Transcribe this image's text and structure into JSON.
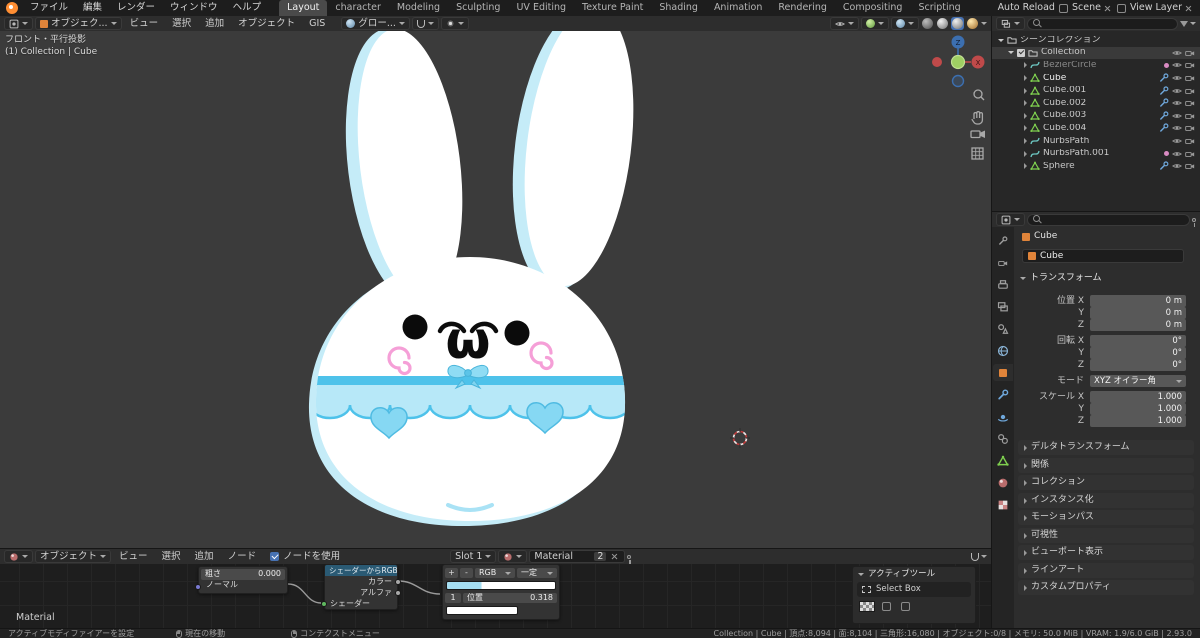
{
  "topbar": {
    "menus": [
      "ファイル",
      "編集",
      "レンダー",
      "ウィンドウ",
      "ヘルプ"
    ],
    "workspaces": [
      "Layout",
      "character",
      "Modeling",
      "Sculpting",
      "UV Editing",
      "Texture Paint",
      "Shading",
      "Animation",
      "Rendering",
      "Compositing",
      "Scripting"
    ],
    "auto_reload": "Auto Reload",
    "scene": "Scene",
    "view_layer": "View Layer"
  },
  "viewport_header": {
    "mode": "オブジェク...",
    "menus": [
      "ビュー",
      "選択",
      "追加",
      "オブジェクト",
      "GIS"
    ],
    "orientation": "グロー..."
  },
  "viewport": {
    "overlay_line1": "フロント・平行投影",
    "overlay_line2": "(1) Collection | Cube",
    "gizmo_z": "Z",
    "gizmo_x": "X",
    "face_mouth": "ω"
  },
  "outliner": {
    "scene_collection": "シーンコレクション",
    "rows": [
      {
        "name": "Collection"
      },
      {
        "name": "BezierCircle"
      },
      {
        "name": "Cube"
      },
      {
        "name": "Cube.001"
      },
      {
        "name": "Cube.002"
      },
      {
        "name": "Cube.003"
      },
      {
        "name": "Cube.004"
      },
      {
        "name": "NurbsPath"
      },
      {
        "name": "NurbsPath.001"
      },
      {
        "name": "Sphere"
      }
    ]
  },
  "properties": {
    "breadcrumb_object": "Cube",
    "object_name": "Cube",
    "transform_title": "トランスフォーム",
    "rows": [
      {
        "label": "位置 X",
        "value": "0 m"
      },
      {
        "label": "Y",
        "value": "0 m"
      },
      {
        "label": "Z",
        "value": "0 m"
      },
      {
        "label": "回転 X",
        "value": "0°"
      },
      {
        "label": "Y",
        "value": "0°"
      },
      {
        "label": "Z",
        "value": "0°"
      },
      {
        "label": "モード",
        "value": "XYZ オイラー角"
      },
      {
        "label": "スケール X",
        "value": "1.000"
      },
      {
        "label": "Y",
        "value": "1.000"
      },
      {
        "label": "Z",
        "value": "1.000"
      }
    ],
    "sections": [
      "デルタトランスフォーム",
      "関係",
      "コレクション",
      "インスタンス化",
      "モーションパス",
      "可視性",
      "ビューポート表示",
      "ラインアート",
      "カスタムプロパティ"
    ]
  },
  "shader": {
    "object_selector": "オブジェクト",
    "menus": [
      "ビュー",
      "選択",
      "追加",
      "ノード"
    ],
    "use_nodes": "ノードを使用",
    "slot": "Slot 1",
    "material_name": "Material",
    "users_count": "2",
    "overlay_material": "Material",
    "node_bsdf": {
      "roughness_label": "粗さ",
      "roughness_value": "0.000",
      "normal_label": "ノーマル"
    },
    "node_shader_to_rgb": {
      "title": "シェーダーからRGBへ",
      "out_color": "カラー",
      "out_alpha": "アルファ",
      "in_shader": "シェーダー"
    },
    "node_ramp": {
      "add": "+",
      "remove": "-",
      "mode": "RGB",
      "interpolation": "一定",
      "index": "1",
      "position_label": "位置",
      "position_value": "0.318"
    },
    "tool_panel": {
      "title": "アクティブツール",
      "tool": "Select Box"
    }
  },
  "statusbar": {
    "left": "アクティブモディファイアーを設定",
    "hint1": "現在の移動",
    "hint2": "コンテクストメニュー",
    "stats": "Collection | Cube | 頂点:8,094 | 面:8,104 | 三角形:16,080 | オブジェクト:0/8 | メモリ: 50.0 MiB | VRAM: 1.9/6.0 GiB | 2.93.0"
  }
}
